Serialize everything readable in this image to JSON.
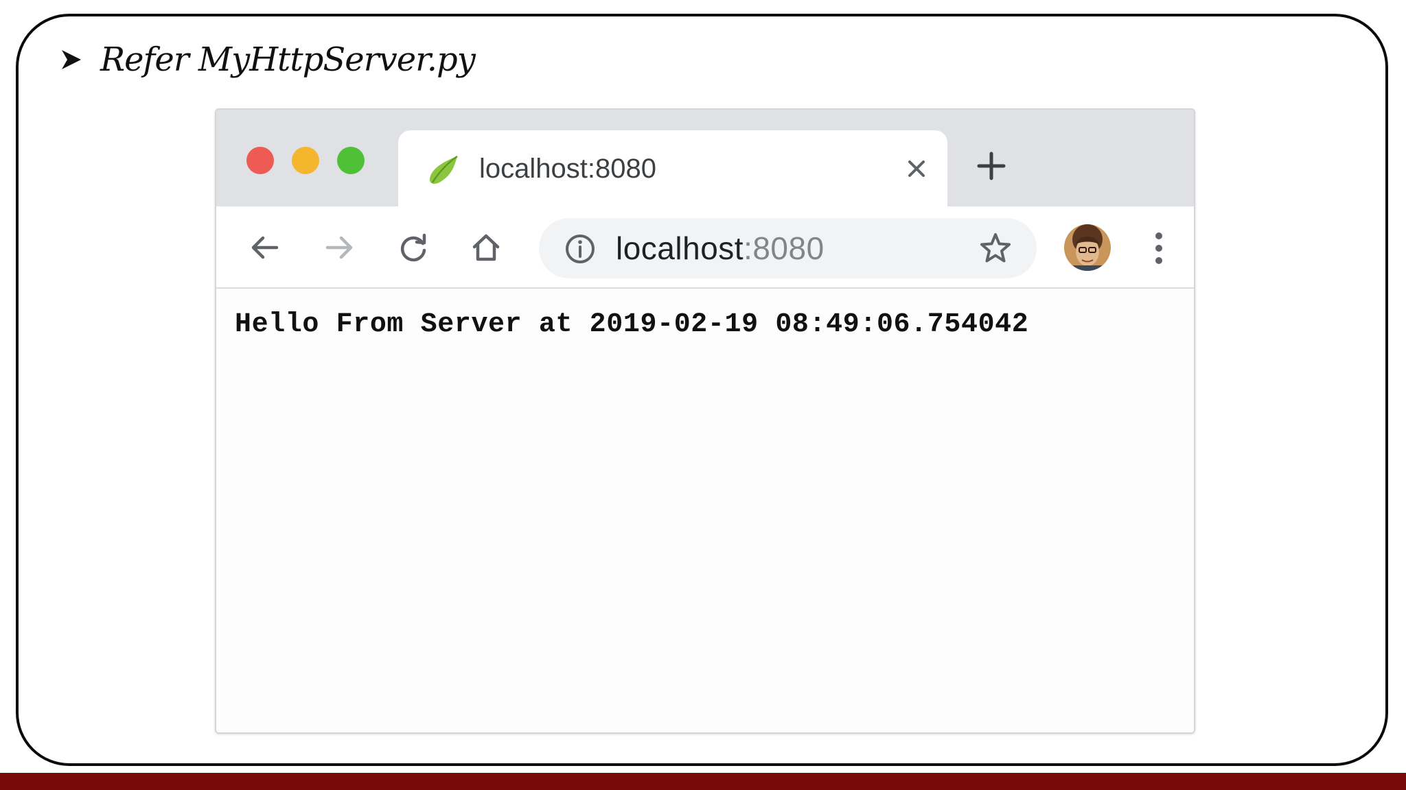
{
  "slide": {
    "heading": "Refer MyHttpServer.py"
  },
  "browser": {
    "tab": {
      "title": "localhost:8080",
      "favicon": "spring-leaf-icon"
    },
    "toolbar": {
      "back_icon": "back-arrow-icon",
      "forward_icon": "forward-arrow-icon",
      "reload_icon": "reload-icon",
      "home_icon": "home-icon",
      "url_host": "localhost",
      "url_port": ":8080",
      "info_icon": "info-icon",
      "bookmark_icon": "star-icon",
      "menu_icon": "kebab-menu-icon"
    },
    "page": {
      "text": "Hello From Server at 2019-02-19 08:49:06.754042"
    }
  },
  "colors": {
    "bottom_bar": "#7a0a0a",
    "tab_strip": "#dfe1e5",
    "close_red": "#ee5b54",
    "minimize_yellow": "#f4b62d",
    "zoom_green": "#4ec136"
  }
}
